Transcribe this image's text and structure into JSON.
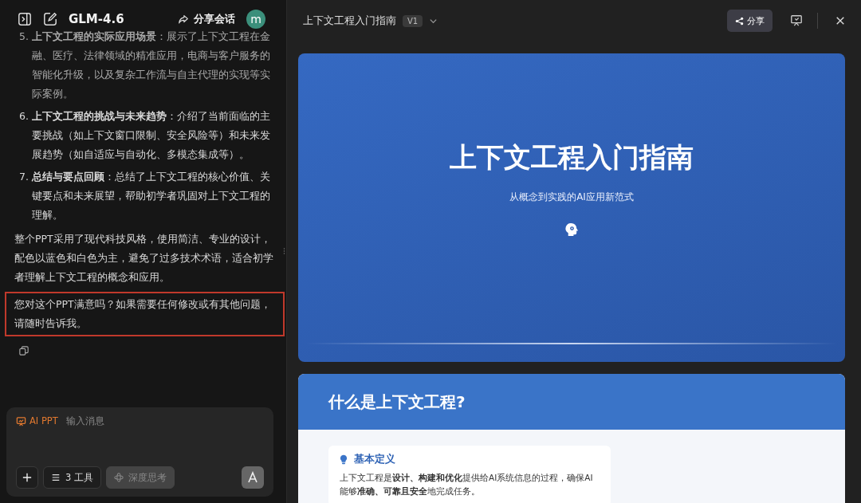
{
  "sidebar_header": {
    "title": "GLM-4.6",
    "share_label": "分享会话",
    "avatar": "m"
  },
  "chat": {
    "list": [
      {
        "number": "5.",
        "text": "**上下文工程的实际应用场景**：展示了上下文工程在金融、医疗、法律领域的精准应用，电商与客户服务的智能化升级，以及复杂工作流与自主代理的实现等实际案例。",
        "faded": true
      },
      {
        "number": "6.",
        "text": "**上下文工程的挑战与未来趋势**：介绍了当前面临的主要挑战（如上下文窗口限制、安全风险等）和未来发展趋势（如自适应与自动化、多模态集成等）。",
        "faded": false
      },
      {
        "number": "7.",
        "text": "**总结与要点回顾**：总结了上下文工程的核心价值、关键要点和未来展望，帮助初学者巩固对上下文工程的理解。",
        "faded": false
      }
    ],
    "paragraph": "整个PPT采用了现代科技风格，使用简洁、专业的设计，配色以蓝色和白色为主，避免了过多技术术语，适合初学者理解上下文工程的概念和应用。",
    "highlighted_paragraph": "您对这个PPT满意吗？如果需要任何修改或有其他问题，请随时告诉我。"
  },
  "composer": {
    "mode": "AI PPT",
    "placeholder": "输入消息",
    "tools_label": "3 工具",
    "deep_think_label": "深度思考",
    "deep_think_on": false
  },
  "preview": {
    "title": "上下文工程入门指南",
    "version": "V1",
    "share_label": "分享"
  },
  "slides": [
    {
      "kind": "cover",
      "title": "上下文工程入门指南",
      "subtitle": "从概念到实践的AI应用新范式"
    },
    {
      "kind": "section",
      "title": "什么是上下文工程?",
      "card_title": "基本定义",
      "card_text": "上下文工程是**设计、构建和优化**提供给AI系统信息的过程，确保AI能够**准确、可靠且安全**地完成任务。"
    }
  ]
}
